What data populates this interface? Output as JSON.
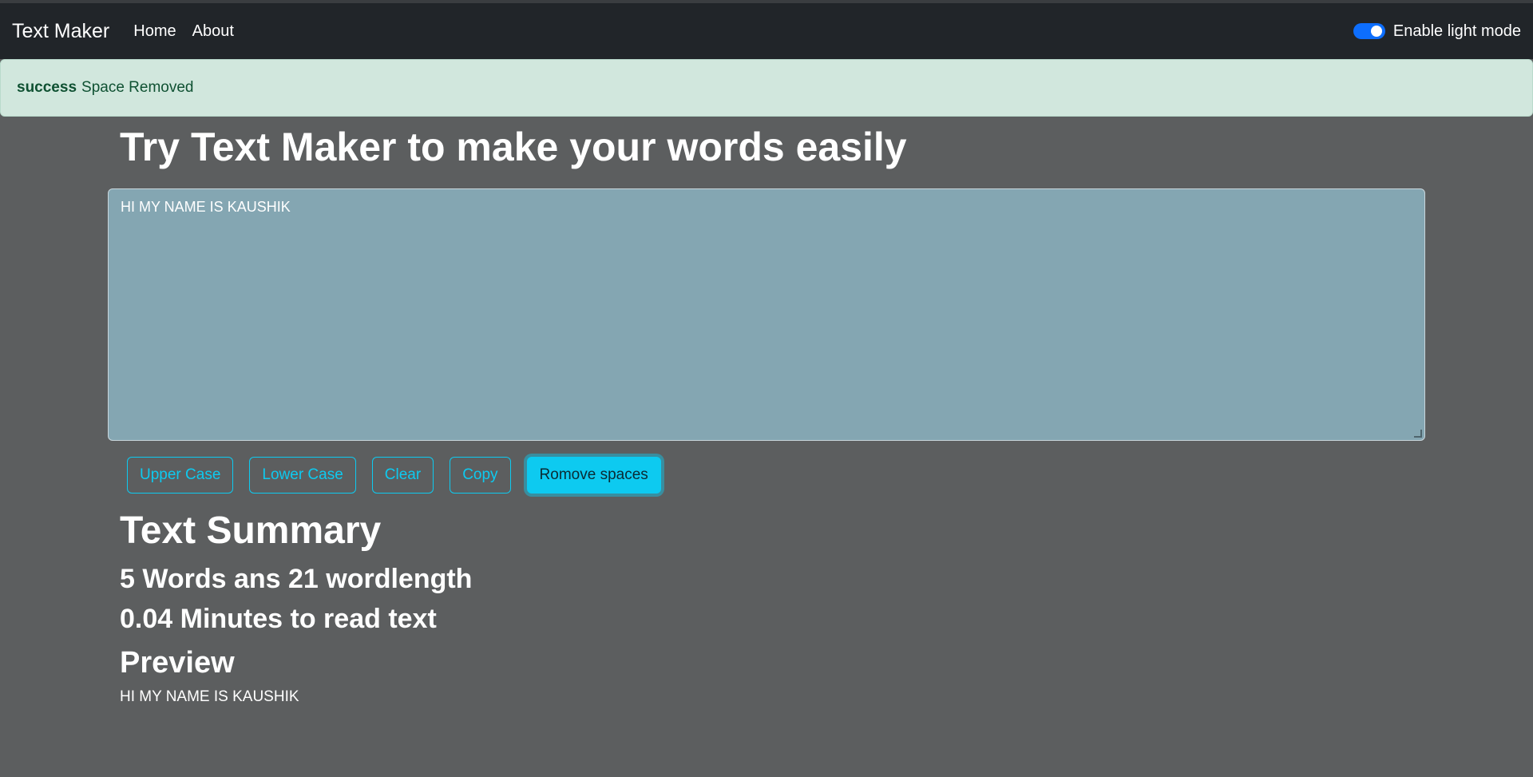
{
  "navbar": {
    "brand": "Text Maker",
    "links": [
      "Home",
      "About"
    ],
    "toggle_label": "Enable light mode",
    "toggle_on": true
  },
  "alert": {
    "type": "success",
    "message": "Space Removed"
  },
  "main": {
    "heading": "Try Text Maker to make your words easily",
    "textarea_value": "HI MY NAME IS KAUSHIK",
    "buttons": [
      "Upper Case",
      "Lower Case",
      "Clear",
      "Copy",
      "Romove spaces"
    ],
    "active_button": "Romove spaces"
  },
  "summary": {
    "heading": "Text Summary",
    "words_line": "5 Words ans 21 wordlength",
    "read_time_line": "0.04 Minutes to read text",
    "preview_heading": "Preview",
    "preview_text": "HI MY NAME IS KAUSHIK"
  },
  "colors": {
    "navbar_bg": "#212529",
    "page_bg": "#5c5e5f",
    "alert_bg": "#d1e7dd",
    "accent": "#0dcaf0",
    "textarea_bg": "#84a6b2"
  }
}
